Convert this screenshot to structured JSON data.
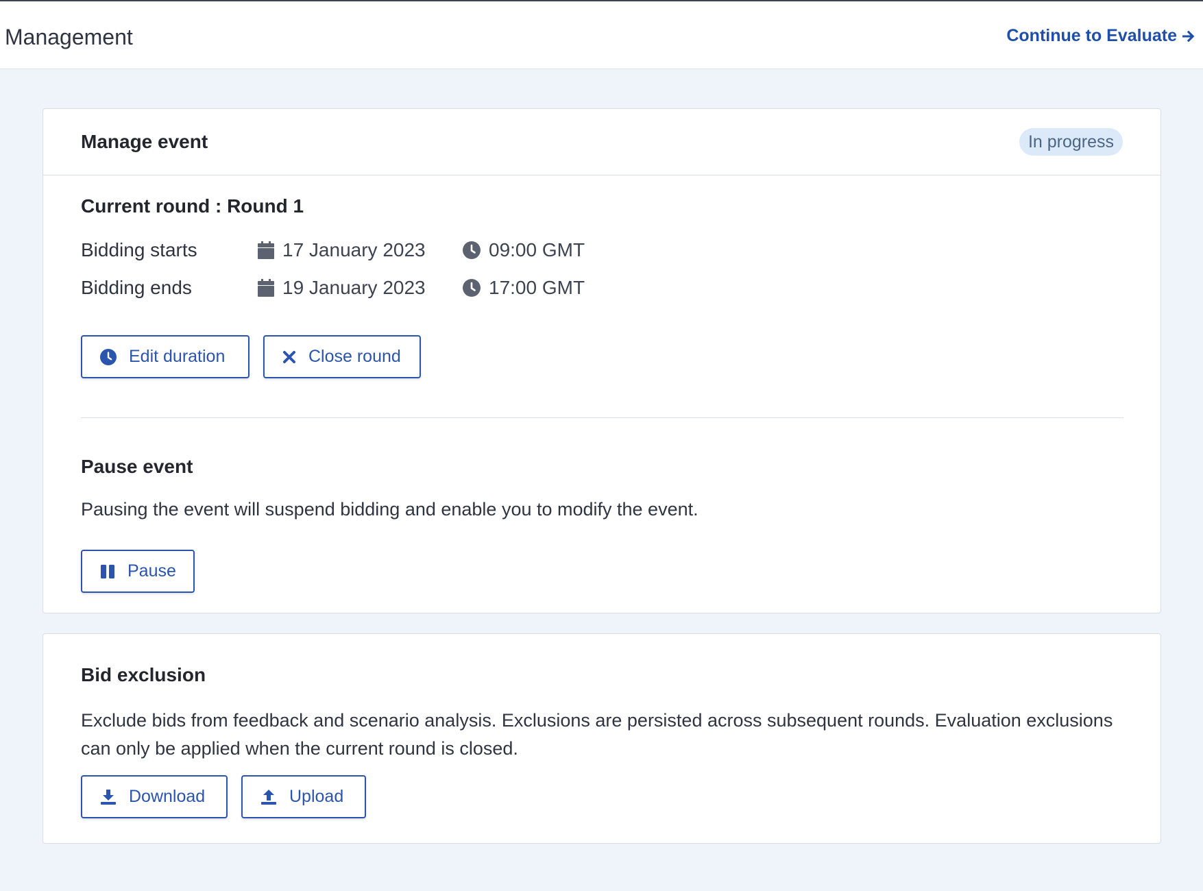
{
  "header": {
    "title": "Management",
    "continue_label": "Continue to Evaluate"
  },
  "manage_event": {
    "title": "Manage event",
    "status": "In progress",
    "current_round": {
      "title": "Current round : Round 1",
      "rows": [
        {
          "label": "Bidding starts",
          "date": "17 January 2023",
          "time": "09:00 GMT"
        },
        {
          "label": "Bidding ends",
          "date": "19 January 2023",
          "time": "17:00 GMT"
        }
      ],
      "edit_duration_label": "Edit duration",
      "close_round_label": "Close round"
    },
    "pause": {
      "title": "Pause event",
      "description": "Pausing the event will suspend bidding and enable you to modify the event.",
      "button_label": "Pause"
    }
  },
  "bid_exclusion": {
    "title": "Bid exclusion",
    "description": "Exclude bids from feedback and scenario analysis. Exclusions are persisted across subsequent rounds. Evaluation exclusions can only be applied when the current round is closed.",
    "download_label": "Download",
    "upload_label": "Upload"
  },
  "colors": {
    "accent": "#2a54ad",
    "badge_bg": "#dbe9f8",
    "page_bg": "#eff3fa"
  }
}
